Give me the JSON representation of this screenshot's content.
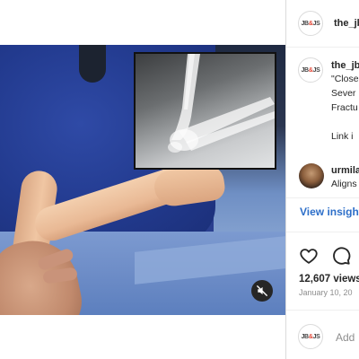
{
  "brand": {
    "logo_text_left": "JB",
    "logo_text_mid": "&",
    "logo_text_right": "JS",
    "accent": "#e34a3a"
  },
  "header": {
    "username": "the_jb"
  },
  "post": {
    "caption_username": "the_jb",
    "caption_lines": [
      "\"Close",
      "Sever",
      "Fractu",
      "",
      "Link i"
    ],
    "media_muted": true
  },
  "comment": {
    "username": "urmila",
    "text": "Aligns"
  },
  "actions": {
    "insights_label": "View insight",
    "like_icon": "heart-icon",
    "comment_icon": "comment-icon"
  },
  "stats": {
    "views": "12,607 views",
    "date": "January 10, 20"
  },
  "composer": {
    "placeholder": "Add"
  },
  "colors": {
    "link": "#2d6fc9",
    "muted_text": "#8e8e8e",
    "divider": "#dbdbdb"
  }
}
